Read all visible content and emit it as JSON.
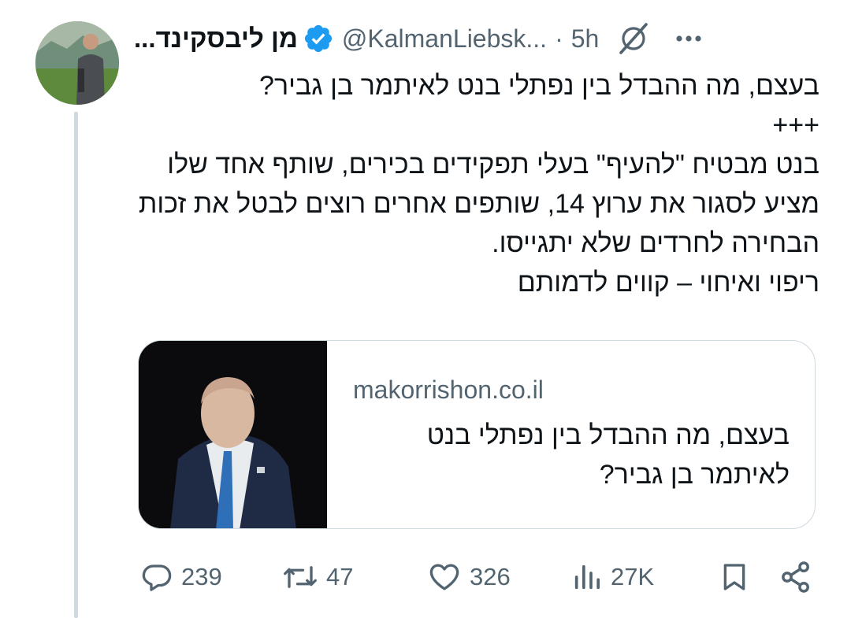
{
  "post": {
    "author": {
      "name": "...מן ליבסקינד",
      "handle": "@KalmanLiebsk...",
      "verified": true
    },
    "separator": "·",
    "time": "5h",
    "text": "בעצם, מה ההבדל בין נפתלי בנט לאיתמר בן גביר?\n+++\nבנט מבטיח \"להעיף\" בעלי תפקידים בכירים, שותף אחד שלו מציע לסגור את ערוץ 14, שותפים אחרים רוצים לבטל את זכות הבחירה לחרדים שלא יתגייסו.\nריפוי ואיחוי – קווים לדמותם",
    "card": {
      "domain": "makorrishon.co.il",
      "title": "בעצם, מה ההבדל בין נפתלי בנט לאיתמר בן גביר?"
    },
    "actions": {
      "replies": "239",
      "reposts": "47",
      "likes": "326",
      "views": "27K"
    }
  },
  "colors": {
    "text": "#0f1419",
    "secondary": "#536471",
    "verified": "#1d9bf0",
    "border": "#cfd9de"
  },
  "icons": [
    "verified-badge-icon",
    "grok-icon",
    "more-icon",
    "reply-icon",
    "repost-icon",
    "like-icon",
    "views-icon",
    "bookmark-icon",
    "share-icon"
  ]
}
